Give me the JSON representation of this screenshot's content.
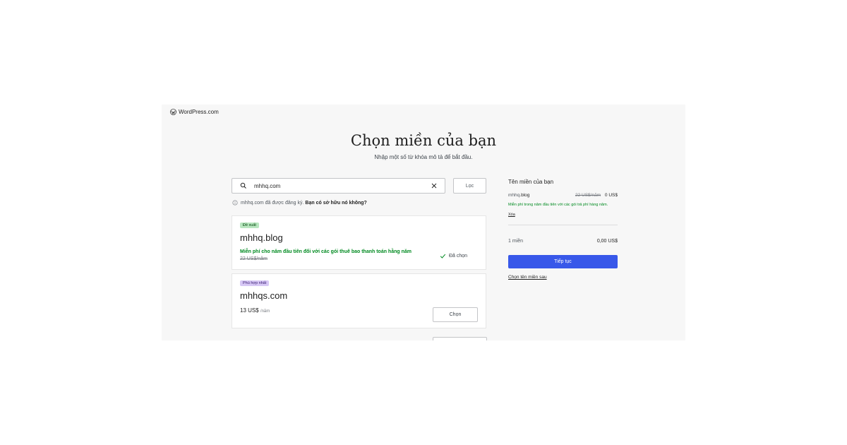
{
  "brand": {
    "name": "WordPress.com",
    "icon": "wordpress-logo-icon"
  },
  "header": {
    "title": "Chọn miền của bạn",
    "subtitle": "Nhập một số từ khóa mô tả để bắt đầu."
  },
  "search": {
    "value": "mhhq.com",
    "icon": "search-icon",
    "clear_icon": "close-icon",
    "filter_label": "Lọc"
  },
  "notice": {
    "domain": "mhhq.com",
    "text": "đã được đăng ký.",
    "link": "Bạn có sở hữu nó không?"
  },
  "results": [
    {
      "badge": "Đề xuất",
      "domain": "mhhq.blog",
      "promo": "Miễn phí cho năm đầu tiên đối với các gói thuê bao thanh toán hằng năm",
      "old_price": "22 US$/năm",
      "status": "Đã chọn"
    },
    {
      "badge": "Phù hợp nhất",
      "domain": "mhhqs.com",
      "price": "13 US$",
      "per": "/năm",
      "button": "Chọn"
    }
  ],
  "sidebar": {
    "heading": "Tên miền của bạn",
    "item": {
      "name_prefix": "mhhq",
      "name_suffix": ".blog",
      "old_price": "22 US$/năm",
      "price": "0 US$",
      "promo": "Miễn phí trong năm đầu tiên với các gói trả phí hàng năm.",
      "remove": "Xóa"
    },
    "total_label": "1 miền",
    "total_value": "0,00 US$",
    "continue": "Tiếp tục",
    "later": "Chọn tên miền sau"
  },
  "colors": {
    "accent": "#3858e9",
    "success": "#008a20",
    "badge_green": "#b8e6bf",
    "badge_purple": "#d7c8f5",
    "frame_bg": "#f7f7f7"
  }
}
